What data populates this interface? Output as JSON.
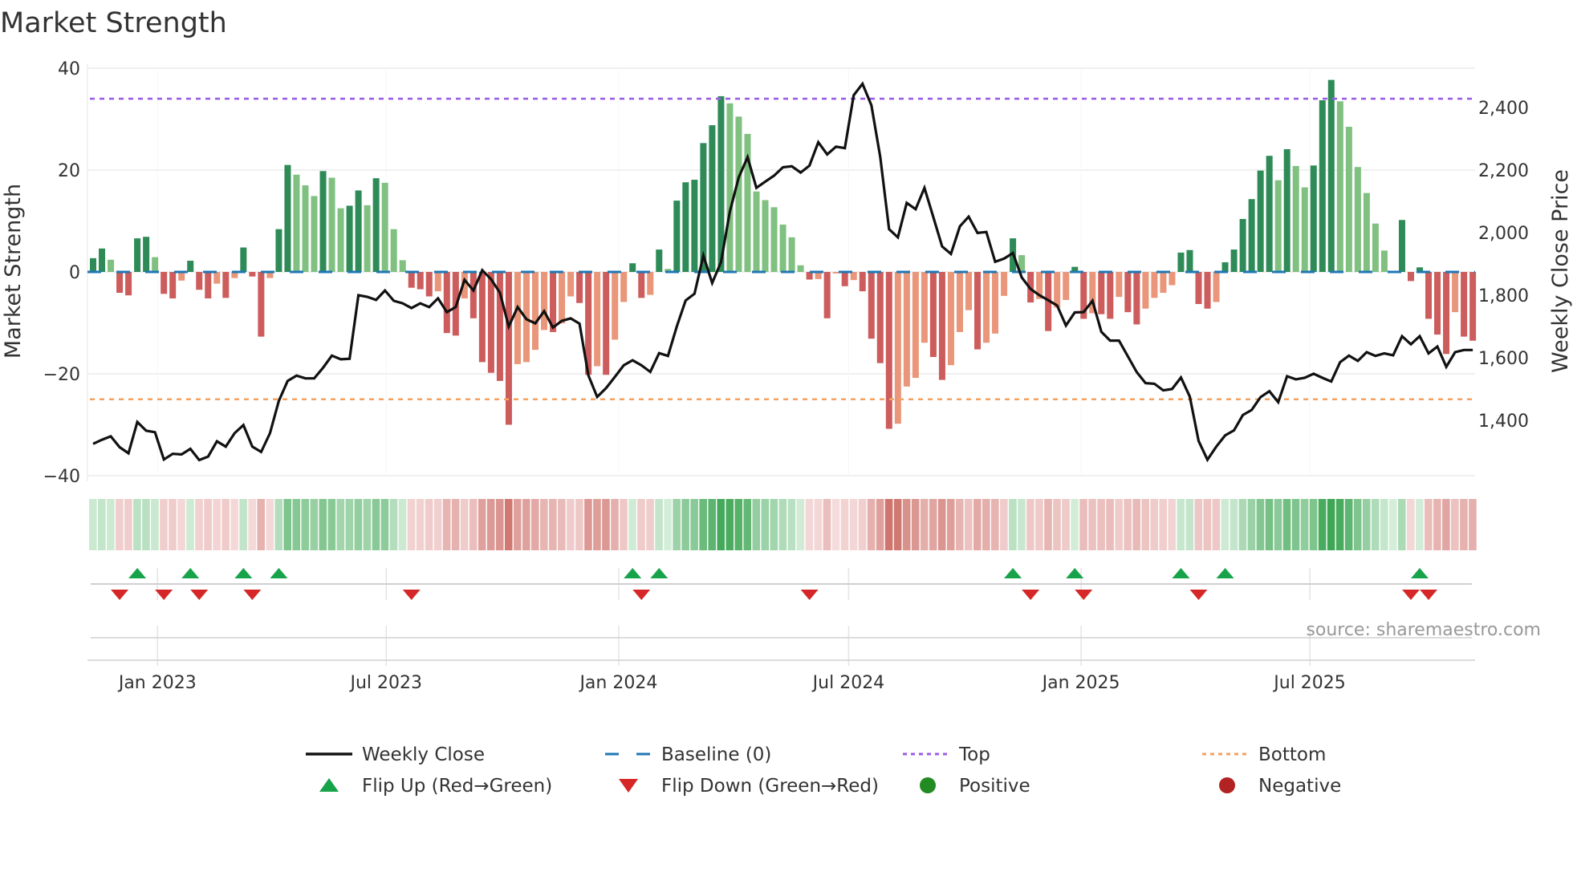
{
  "title": "Market Strength",
  "source": "source: sharemaestro.com",
  "chart_data": {
    "type": "bar+line",
    "title": "Market Strength",
    "ylabel": "Market Strength",
    "y2label": "Weekly Close Price",
    "ylim": [
      -40,
      40
    ],
    "y2lim": [
      1200,
      2475
    ],
    "yticks": [
      {
        "v": 40,
        "label": "40"
      },
      {
        "v": 20,
        "label": "20"
      },
      {
        "v": 0,
        "label": "0"
      },
      {
        "v": -20,
        "label": "−20"
      },
      {
        "v": -40,
        "label": "−40"
      }
    ],
    "y2ticks": [
      {
        "v": 2400,
        "label": "2,400"
      },
      {
        "v": 2200,
        "label": "2,200"
      },
      {
        "v": 2000,
        "label": "2,000"
      },
      {
        "v": 1800,
        "label": "1,800"
      },
      {
        "v": 1600,
        "label": "1,600"
      },
      {
        "v": 1400,
        "label": "1,400"
      }
    ],
    "xticks": [
      {
        "date": "2023-01-01",
        "label": "Jan 2023"
      },
      {
        "date": "2023-07-01",
        "label": "Jul 2023"
      },
      {
        "date": "2024-01-01",
        "label": "Jan 2024"
      },
      {
        "date": "2024-07-01",
        "label": "Jul 2024"
      },
      {
        "date": "2025-01-01",
        "label": "Jan 2025"
      },
      {
        "date": "2025-07-01",
        "label": "Jul 2025"
      }
    ],
    "x_start": "2022-11-11",
    "x_step_days": 7,
    "top_level": 34,
    "bottom_level": -25,
    "baseline": 0,
    "strength": [
      2.7,
      4.6,
      2.4,
      -4.1,
      -4.6,
      6.6,
      6.9,
      2.9,
      -4.3,
      -5.2,
      -1.7,
      2.2,
      -3.5,
      -5.2,
      -2.3,
      -5.1,
      -1.2,
      4.8,
      -0.9,
      -12.7,
      -1.2,
      8.4,
      21,
      19.1,
      17,
      14.9,
      19.8,
      18.5,
      12.5,
      13,
      16,
      13.1,
      18.4,
      17.5,
      8.4,
      2.3,
      -3.1,
      -3.4,
      -4.8,
      -3.8,
      -12,
      -12.5,
      -5.2,
      -9.1,
      -17.7,
      -19.8,
      -21.4,
      -30,
      -18.1,
      -17.7,
      -15.3,
      -11.4,
      -11.8,
      -10.1,
      -4.8,
      -6.1,
      -20.2,
      -18.5,
      -20.2,
      -13.3,
      -5.9,
      1.7,
      -5.1,
      -4.5,
      4.4,
      0.6,
      14,
      17.6,
      18.1,
      25.3,
      28.8,
      34.5,
      33.1,
      30.5,
      27.1,
      15.8,
      14.1,
      12.7,
      9.3,
      6.8,
      1.3,
      -1.5,
      -1.4,
      -9.1,
      -0.3,
      -2.8,
      -1.6,
      -3.8,
      -13.1,
      -17.9,
      -30.8,
      -29.8,
      -22.5,
      -20.8,
      -13.9,
      -16.7,
      -21.2,
      -18.3,
      -11.8,
      -7.5,
      -15.2,
      -13.9,
      -12.1,
      -4.7,
      6.6,
      3.3,
      -6,
      -5.3,
      -11.6,
      -7,
      -5.5,
      1.0,
      -9.2,
      -8.1,
      -8.3,
      -9.2,
      -4.9,
      -7.9,
      -10.3,
      -7.2,
      -5.1,
      -4.1,
      -2.6,
      3.8,
      4.3,
      -6.3,
      -7.2,
      -5.9,
      1.9,
      4.4,
      10.4,
      14.3,
      19.9,
      22.8,
      18,
      24.1,
      20.8,
      16.6,
      20.9,
      33.7,
      37.7,
      33.5,
      28.5,
      20.6,
      15.5,
      9.5,
      4.2,
      0.2,
      10.2,
      -1.8,
      0.9,
      -9.2,
      -12.3,
      -16.1,
      -7.9,
      -12.7,
      -13.5
    ],
    "weekly_close": [
      1325,
      1338,
      1349,
      1314,
      1295,
      1395,
      1367,
      1362,
      1275,
      1293,
      1291,
      1309,
      1273,
      1284,
      1333,
      1316,
      1359,
      1385,
      1316,
      1299,
      1359,
      1462,
      1526,
      1543,
      1534,
      1534,
      1568,
      1607,
      1595,
      1597,
      1800,
      1795,
      1785,
      1815,
      1782,
      1774,
      1759,
      1774,
      1762,
      1790,
      1746,
      1762,
      1849,
      1815,
      1880,
      1851,
      1808,
      1700,
      1762,
      1723,
      1710,
      1749,
      1697,
      1718,
      1726,
      1709,
      1544,
      1475,
      1503,
      1539,
      1576,
      1592,
      1576,
      1555,
      1615,
      1606,
      1700,
      1783,
      1805,
      1927,
      1839,
      1906,
      2067,
      2177,
      2241,
      2143,
      2163,
      2182,
      2209,
      2212,
      2192,
      2214,
      2289,
      2250,
      2275,
      2270,
      2439,
      2476,
      2407,
      2242,
      2011,
      1985,
      2095,
      2075,
      2143,
      2050,
      1956,
      1932,
      2020,
      2051,
      1999,
      2002,
      1907,
      1917,
      1935,
      1857,
      1820,
      1800,
      1784,
      1767,
      1703,
      1745,
      1746,
      1782,
      1683,
      1655,
      1655,
      1605,
      1554,
      1519,
      1517,
      1496,
      1500,
      1537,
      1476,
      1334,
      1274,
      1316,
      1352,
      1368,
      1417,
      1433,
      1474,
      1493,
      1458,
      1541,
      1531,
      1536,
      1549,
      1536,
      1524,
      1586,
      1607,
      1590,
      1618,
      1606,
      1614,
      1608,
      1669,
      1643,
      1669,
      1614,
      1636,
      1571,
      1618,
      1625,
      1625
    ],
    "flip_up_weeks": [
      6,
      12,
      18,
      22,
      62,
      65,
      105,
      112,
      124,
      129,
      151
    ],
    "flip_down_weeks": [
      4,
      9,
      13,
      19,
      37,
      63,
      82,
      107,
      113,
      126,
      150,
      152
    ],
    "colors": {
      "pos_rising": "#2e8b57",
      "pos_falling": "#80c080",
      "neg_falling": "#cd5c5c",
      "neg_rising": "#e9967a",
      "close": "#111111",
      "baseline": "#1f77b4",
      "top": "#9b5de5",
      "bottom": "#f4a261",
      "flip_up": "#17a34a",
      "flip_down": "#d62728",
      "positive": "#228b22",
      "negative": "#b22222"
    },
    "legend": {
      "placement": "bottom",
      "items": [
        {
          "key": "close",
          "label": "Weekly Close"
        },
        {
          "key": "baseline",
          "label": "Baseline (0)"
        },
        {
          "key": "top",
          "label": "Top"
        },
        {
          "key": "bottom",
          "label": "Bottom"
        },
        {
          "key": "flip_up",
          "label": "Flip Up (Red→Green)"
        },
        {
          "key": "flip_down",
          "label": "Flip Down (Green→Red)"
        },
        {
          "key": "positive",
          "label": "Positive"
        },
        {
          "key": "negative",
          "label": "Negative"
        }
      ]
    }
  }
}
